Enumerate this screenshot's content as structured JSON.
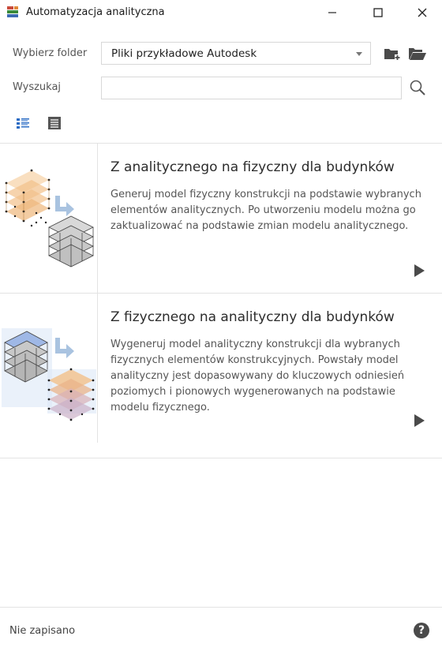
{
  "window": {
    "title": "Automatyzacja analityczna",
    "controls": {
      "minimize": "—",
      "maximize": "☐",
      "close": "✕"
    }
  },
  "folder": {
    "label": "Wybierz folder",
    "selected": "Pliki przykładowe Autodesk"
  },
  "search": {
    "label": "Wyszukaj",
    "value": "",
    "placeholder": ""
  },
  "view_modes": [
    "list-detail-view-icon",
    "list-compact-view-icon"
  ],
  "cards": [
    {
      "title": "Z analitycznego na fizyczny dla budynków",
      "description": "Generuj model fizyczny konstrukcji na podstawie wybranych elementów analitycznych. Po utworzeniu modelu można go zaktualizować na podstawie zmian modelu analitycznego."
    },
    {
      "title": "Z fizycznego na analityczny dla budynków",
      "description": "Wygeneruj model analityczny konstrukcji dla wybranych fizycznych elementów konstrukcyjnych. Powstały model analityczny jest dopasowywany do kluczowych odniesień poziomych i pionowych wygenerowanych na podstawie modelu fizycznego."
    }
  ],
  "status": {
    "text": "Nie zapisano"
  },
  "help": {
    "glyph": "?"
  },
  "colors": {
    "accent_orange": "#f2c08a",
    "accent_blue": "#9fb8e6",
    "icon_blue": "#2b6cc4",
    "dark_icon": "#4a4a4a"
  }
}
